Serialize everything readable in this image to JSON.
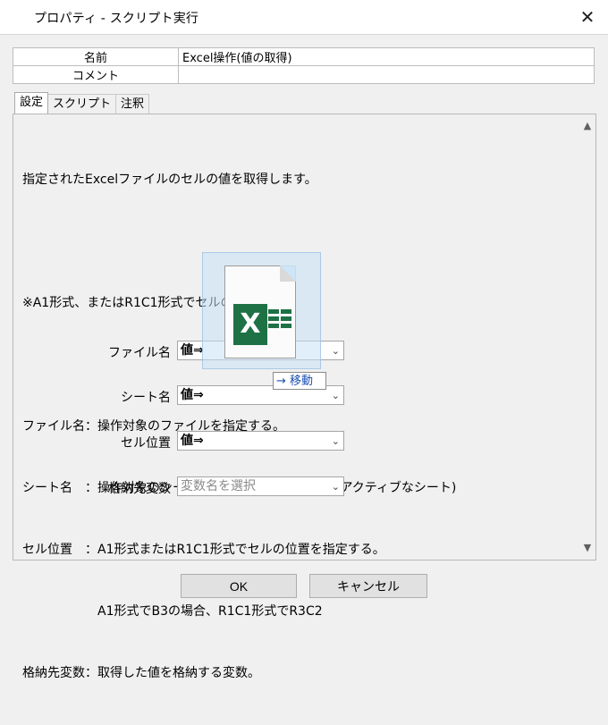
{
  "window": {
    "title": "プロパティ - スクリプト実行",
    "close_glyph": "✕"
  },
  "properties": [
    {
      "key": "名前",
      "value": "Excel操作(値の取得)"
    },
    {
      "key": "コメント",
      "value": ""
    }
  ],
  "tabs": [
    {
      "label": "設定",
      "active": true
    },
    {
      "label": "スクリプト",
      "active": false
    },
    {
      "label": "注釈",
      "active": false
    }
  ],
  "description": [
    "指定されたExcelファイルのセルの値を取得します。",
    "",
    "※A1形式、またはR1C1形式でセルの指定可能",
    "",
    "ファイル名：操作対象のファイルを指定する。",
    "シート名　：操作対象のシートを指定する。(空の場合はアクティブなシート)",
    "セル位置　：A1形式またはR1C1形式でセルの位置を指定する。",
    "　　　　　　A1形式でB3の場合、R1C1形式でR3C2",
    "格納先変数：取得した値を格納する変数。"
  ],
  "fields": [
    {
      "label": "ファイル名",
      "value": "値⇒",
      "placeholder": false
    },
    {
      "label": "シート名",
      "value": "値⇒",
      "placeholder": false
    },
    {
      "label": "セル位置",
      "value": "値⇒",
      "placeholder": false
    },
    {
      "label": "格納先変数",
      "value": "変数名を選択",
      "placeholder": true
    }
  ],
  "drag": {
    "icon": "excel-file-icon",
    "badge_letter": "X",
    "tooltip": "→ 移動"
  },
  "buttons": {
    "ok": "OK",
    "cancel": "キャンセル"
  },
  "scroll": {
    "up_glyph": "▲",
    "down_glyph": "▼"
  },
  "colors": {
    "excel_green": "#1e7145",
    "drag_blue": "#1a4fb3"
  }
}
